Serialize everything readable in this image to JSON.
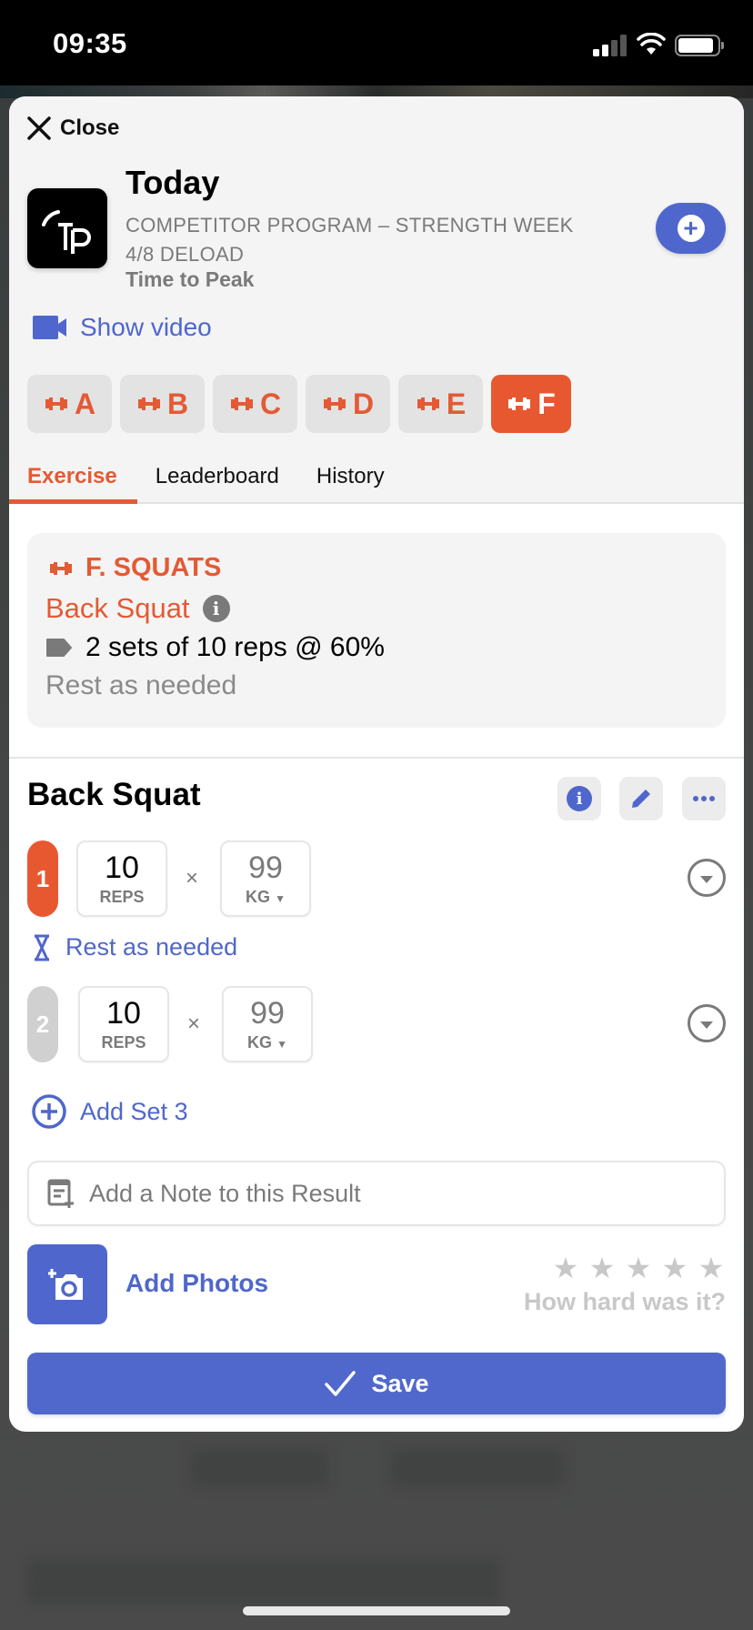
{
  "status_bar": {
    "time": "09:35"
  },
  "header": {
    "close_label": "Close",
    "title": "Today",
    "subtitle": "COMPETITOR PROGRAM – STRENGTH WEEK 4/8 DELOAD",
    "coach": "Time to Peak",
    "logo_text": "TP",
    "show_video_label": "Show video"
  },
  "segments": [
    {
      "label": "A",
      "active": false
    },
    {
      "label": "B",
      "active": false
    },
    {
      "label": "C",
      "active": false
    },
    {
      "label": "D",
      "active": false
    },
    {
      "label": "E",
      "active": false
    },
    {
      "label": "F",
      "active": true
    }
  ],
  "tabs": [
    {
      "label": "Exercise",
      "active": true
    },
    {
      "label": "Leaderboard",
      "active": false
    },
    {
      "label": "History",
      "active": false
    }
  ],
  "info_card": {
    "section": "F. SQUATS",
    "exercise": "Back Squat",
    "prescription": "2 sets of 10 reps @ 60%",
    "rest": "Rest as needed"
  },
  "exercise": {
    "title": "Back Squat",
    "sets": [
      {
        "number": "1",
        "reps": "10",
        "reps_unit": "REPS",
        "weight": "99",
        "weight_unit": "KG",
        "active": true
      },
      {
        "number": "2",
        "reps": "10",
        "reps_unit": "REPS",
        "weight": "99",
        "weight_unit": "KG",
        "active": false
      }
    ],
    "times_symbol": "×",
    "rest_label": "Rest as needed",
    "add_set_label": "Add Set 3"
  },
  "note": {
    "placeholder": "Add a Note to this Result"
  },
  "photos": {
    "label": "Add Photos"
  },
  "rating": {
    "label": "How hard was it?",
    "value": 0,
    "max": 5
  },
  "save_label": "Save",
  "colors": {
    "accent_orange": "#e45a35",
    "accent_blue": "#4f67cc",
    "muted": "#7a7a7a"
  }
}
